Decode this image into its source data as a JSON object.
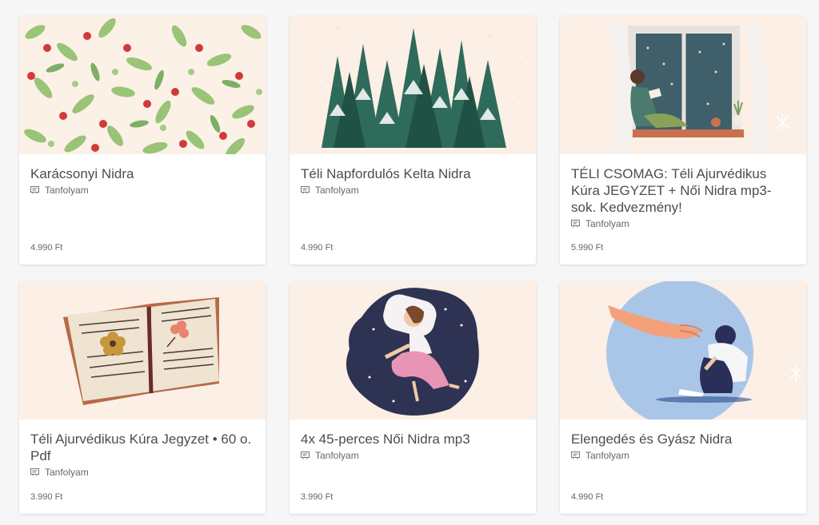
{
  "products": [
    {
      "title": "Karácsonyi Nidra",
      "type": "Tanfolyam",
      "price": "4.990 Ft",
      "image": "christmas-leaves-berries"
    },
    {
      "title": "Téli Napfordulós Kelta Nidra",
      "type": "Tanfolyam",
      "price": "4.990 Ft",
      "image": "snowy-pine-forest"
    },
    {
      "title": "TÉLI CSOMAG: Téli Ajurvédikus Kúra JEGYZET + Női Nidra mp3-sok. Kedvezmény!",
      "type": "Tanfolyam",
      "price": "5.990 Ft",
      "image": "woman-reading-by-window"
    },
    {
      "title": "Téli Ajurvédikus Kúra Jegyzet • 60 o. Pdf",
      "type": "Tanfolyam",
      "price": "3.990 Ft",
      "image": "open-book-flowers"
    },
    {
      "title": "4x 45-perces Női Nidra mp3",
      "type": "Tanfolyam",
      "price": "3.990 Ft",
      "image": "sleeping-woman-night-sky"
    },
    {
      "title": "Elengedés és Gyász Nidra",
      "type": "Tanfolyam",
      "price": "4.990 Ft",
      "image": "helping-hand-grief"
    }
  ],
  "colors": {
    "card_bg": "#ffffff",
    "thumb_bg": "#fcefe7",
    "text": "#4d4d4d"
  }
}
